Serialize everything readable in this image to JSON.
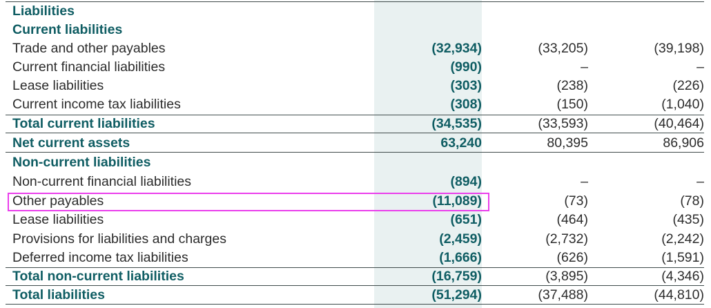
{
  "colors": {
    "accent": "#0f5d63",
    "text": "#2b2b2b",
    "highlight_column": "#e9f1f1",
    "highlight_box": "#ea3dec",
    "rule": "#3e4a4a"
  },
  "rows": [
    {
      "label": "Liabilities",
      "v1": "",
      "v2": "",
      "v3": ""
    },
    {
      "label": "Current liabilities",
      "v1": "",
      "v2": "",
      "v3": ""
    },
    {
      "label": "Trade and other payables",
      "v1": "(32,934)",
      "v2": "(33,205)",
      "v3": "(39,198)"
    },
    {
      "label": "Current financial liabilities",
      "v1": "(990)",
      "v2": "–",
      "v3": "–"
    },
    {
      "label": "Lease liabilities",
      "v1": "(303)",
      "v2": "(238)",
      "v3": "(226)"
    },
    {
      "label": "Current income tax liabilities",
      "v1": "(308)",
      "v2": "(150)",
      "v3": "(1,040)"
    },
    {
      "label": "Total current liabilities",
      "v1": "(34,535)",
      "v2": "(33,593)",
      "v3": "(40,464)"
    },
    {
      "label": "Net current assets",
      "v1": "63,240",
      "v2": "80,395",
      "v3": "86,906"
    },
    {
      "label": "Non-current liabilities",
      "v1": "",
      "v2": "",
      "v3": ""
    },
    {
      "label": "Non-current financial liabilities",
      "v1": "(894)",
      "v2": "–",
      "v3": "–"
    },
    {
      "label": "Other payables",
      "v1": "(11,089)",
      "v2": "(73)",
      "v3": "(78)"
    },
    {
      "label": "Lease liabilities",
      "v1": "(651)",
      "v2": "(464)",
      "v3": "(435)"
    },
    {
      "label": "Provisions for liabilities and charges",
      "v1": "(2,459)",
      "v2": "(2,732)",
      "v3": "(2,242)"
    },
    {
      "label": "Deferred income tax liabilities",
      "v1": "(1,666)",
      "v2": "(626)",
      "v3": "(1,591)"
    },
    {
      "label": "Total non-current liabilities",
      "v1": "(16,759)",
      "v2": "(3,895)",
      "v3": "(4,346)"
    },
    {
      "label": "Total liabilities",
      "v1": "(51,294)",
      "v2": "(37,488)",
      "v3": "(44,810)"
    }
  ]
}
